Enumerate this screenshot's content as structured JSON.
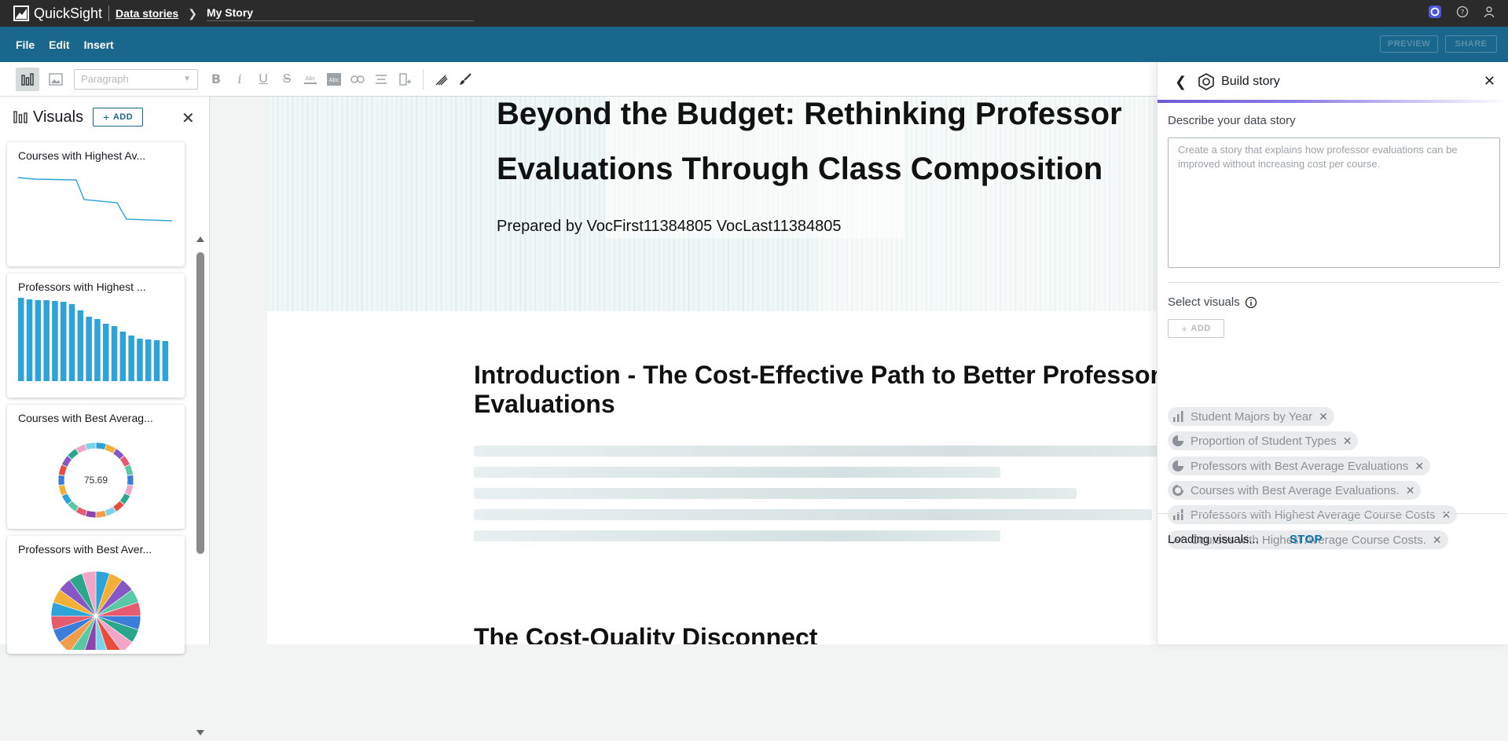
{
  "app": {
    "name": "QuickSight"
  },
  "breadcrumb": {
    "parent": "Data stories",
    "current": "My Story"
  },
  "menu": {
    "file": "File",
    "edit": "Edit",
    "insert": "Insert",
    "preview": "PREVIEW",
    "share": "SHARE"
  },
  "toolbar": {
    "paragraph": "Paragraph",
    "bold": "B",
    "italic": "i",
    "underline": "U",
    "strike": "S"
  },
  "visuals": {
    "title": "Visuals",
    "add": "ADD",
    "cards": [
      {
        "title": "Courses with Highest Av...",
        "type": "line"
      },
      {
        "title": "Professors with Highest ...",
        "type": "bar"
      },
      {
        "title": "Courses with Best Averag...",
        "type": "donut",
        "value": "75.69"
      },
      {
        "title": "Professors with Best Aver...",
        "type": "pie"
      }
    ]
  },
  "story": {
    "title_line1": "Beyond the Budget: Rethinking Professor",
    "title_line2": "Evaluations Through Class Composition",
    "prepared_by": "Prepared by VocFirst11384805 VocLast11384805",
    "section1_line1": "Introduction - The Cost-Effective Path to Better Professor",
    "section1_line2": "Evaluations",
    "section2": "The Cost-Quality Disconnect"
  },
  "panel": {
    "title": "Build story",
    "describe_label": "Describe your data story",
    "describe_text": "Create a story that explains how professor evaluations can be improved without increasing cost per course.",
    "select_label": "Select visuals",
    "add": "ADD",
    "chips": [
      {
        "label": "Student Majors by Year",
        "icon": "bar-chart-icon"
      },
      {
        "label": "Proportion of Student Types",
        "icon": "pie-chart-icon"
      },
      {
        "label": "Professors with Best Average Evaluations",
        "icon": "pie-chart-icon"
      },
      {
        "label": "Courses with Best Average Evaluations.",
        "icon": "donut-chart-icon"
      },
      {
        "label": "Professors with Highest Average Course Costs",
        "icon": "bar-chart-icon"
      },
      {
        "label": "Courses with Highest Average Course Costs.",
        "icon": "line-chart-icon"
      }
    ],
    "loading": "Loading visuals...",
    "stop": "STOP"
  },
  "colors": {
    "topbar": "#2b2b2b",
    "menubar": "#19678d",
    "accent": "#19678d",
    "bars": "#2ea3d8"
  }
}
